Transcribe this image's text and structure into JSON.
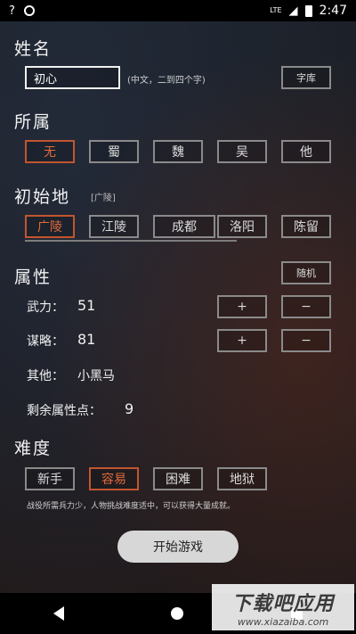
{
  "statusbar": {
    "time": "2:47",
    "lte": "LTE"
  },
  "name": {
    "title": "姓名",
    "value": "初心",
    "hint": "(中文，二到四个字)",
    "lib_button": "字库"
  },
  "faction": {
    "title": "所属",
    "options": [
      "无",
      "蜀",
      "魏",
      "吴",
      "他"
    ],
    "selected": 0
  },
  "origin": {
    "title": "初始地",
    "tag": "[广陵]",
    "options": [
      "广陵",
      "江陵",
      "成都",
      "洛阳",
      "陈留"
    ],
    "selected": 0
  },
  "attributes": {
    "title": "属性",
    "random_button": "随机",
    "wuli_label": "武力：",
    "wuli_value": "51",
    "moulue_label": "谋略：",
    "moulue_value": "81",
    "other_label": "其他：",
    "other_value": "小黑马",
    "remaining_label": "剩余属性点：",
    "remaining_value": "9",
    "plus": "+",
    "minus": "−"
  },
  "difficulty": {
    "title": "难度",
    "options": [
      "新手",
      "容易",
      "困难",
      "地狱"
    ],
    "selected": 1,
    "note": "战役所需兵力少，人物挑战难度适中，可以获得大量成就。"
  },
  "start_button": "开始游戏",
  "watermark": {
    "main": "下载吧应用",
    "sub": "www.xiazaiba.com"
  },
  "colors": {
    "selected": "#e06a3c",
    "border": "#8a8a8a"
  }
}
